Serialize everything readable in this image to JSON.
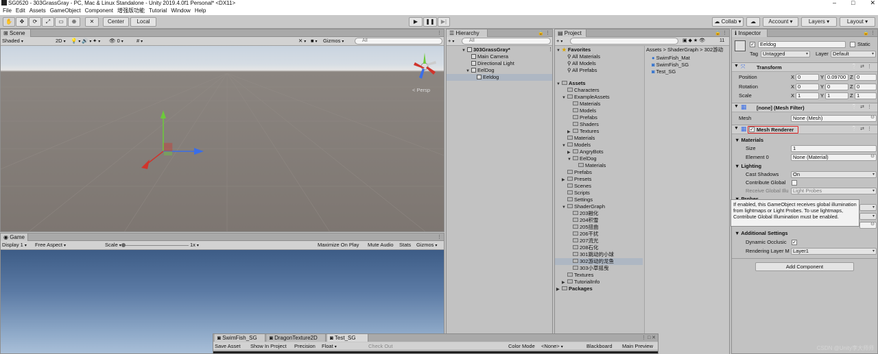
{
  "window": {
    "title": "SG0520 - 303GrassGray - PC, Mac & Linux Standalone - Unity 2019.4.0f1 Personal* <DX11>",
    "controls": [
      "–",
      "□",
      "✕"
    ]
  },
  "menu": [
    "File",
    "Edit",
    "Assets",
    "GameObject",
    "Component",
    "增强版功能",
    "Tutorial",
    "Window",
    "Help"
  ],
  "toolbar": {
    "pivot_label": "Center",
    "space_label": "Local",
    "play": "▶",
    "pause": "❚❚",
    "step": "▶|",
    "collab_label": "Collab",
    "account_label": "Account",
    "layers_label": "Layers",
    "layout_label": "Layout"
  },
  "scene": {
    "tab": "Scene",
    "shading": "Shaded",
    "mode_2d": "2D",
    "hidden_count": "0",
    "gizmos": "Gizmos",
    "search_placeholder": "All",
    "persp_label": "< Persp",
    "colors": {
      "x": "#d0342c",
      "y": "#6ccb3a",
      "z": "#3a6ee8"
    }
  },
  "game": {
    "tab": "Game",
    "display": "Display 1",
    "aspect": "Free Aspect",
    "scale_label": "Scale",
    "scale_value": "1x",
    "maximize": "Maximize On Play",
    "mute": "Mute Audio",
    "stats": "Stats",
    "gizmos": "Gizmos"
  },
  "hierarchy": {
    "tab": "Hierarchy",
    "search_placeholder": "All",
    "scene_name": "303GrassGray*",
    "items": [
      "Main Camera",
      "Directional Light",
      "EelDog",
      "Eeldog"
    ]
  },
  "project": {
    "tab": "Project",
    "count": "11",
    "favorites_label": "Favorites",
    "favorites": [
      "All Materials",
      "All Models",
      "All Prefabs"
    ],
    "assets_label": "Assets",
    "tree": [
      "Characters",
      "ExampleAssets",
      "Materials",
      "Models",
      "Prefabs",
      "Shaders",
      "Textures",
      "Materials",
      "Models",
      "AngryBots",
      "EelDog",
      "Materials",
      "Prefabs",
      "Presets",
      "Scenes",
      "Scripts",
      "Settings",
      "ShaderGraph",
      "203融化",
      "204积雪",
      "205扭曲",
      "206干扰",
      "207流光",
      "208石化",
      "301跳动的小球",
      "302游动的龙鱼",
      "303小草摇曳",
      "Textures",
      "TutorialInfo"
    ],
    "packages_label": "Packages",
    "breadcrumb": "Assets > ShaderGraph > 302游动",
    "files": [
      "SwimFish_Mat",
      "SwimFish_SG",
      "Test_SG"
    ]
  },
  "shadergraph": {
    "tabs": [
      "SwimFish_SG",
      "DragonTexture2D",
      "Test_SG"
    ],
    "save": "Save Asset",
    "show": "Show In Project",
    "precision_label": "Precision",
    "precision_value": "Float",
    "checkout": "Check Out",
    "colormode_label": "Color Mode",
    "colormode_value": "<None>",
    "blackboard": "Blackboard",
    "preview": "Main Preview"
  },
  "inspector": {
    "tab": "Inspector",
    "object_name": "Eeldog",
    "static_label": "Static",
    "tag_label": "Tag",
    "tag_value": "Untagged",
    "layer_label": "Layer",
    "layer_value": "Default",
    "transform": {
      "title": "Transform",
      "position_label": "Position",
      "position": [
        "0",
        "0.09700",
        "0"
      ],
      "rotation_label": "Rotation",
      "rotation": [
        "0",
        "0",
        "0"
      ],
      "scale_label": "Scale",
      "scale": [
        "1",
        "1",
        "1"
      ]
    },
    "mesh_filter": {
      "title": "[none] (Mesh Filter)",
      "mesh_label": "Mesh",
      "mesh_value": "None (Mesh)"
    },
    "mesh_renderer": {
      "title": "Mesh Renderer",
      "materials_label": "Materials",
      "size_label": "Size",
      "size_value": "1",
      "element_label": "Element 0",
      "element_value": "None (Material)",
      "lighting_label": "Lighting",
      "cast_label": "Cast Shadows",
      "cast_value": "On",
      "contrib_label": "Contribute Global",
      "receive_label": "Receive Global Illu",
      "receive_value": "Light Probes",
      "probes_label": "Probes",
      "tooltip": "If enabled, this GameObject receives global illumination from lightmaps or Light Probes. To use lightmaps, Contribute Global Illumination must be enabled.",
      "additional_label": "Additional Settings",
      "dynamic_label": "Dynamic Occlusic",
      "rendering_label": "Rendering Layer M",
      "rendering_value": "Layer1"
    },
    "add_component": "Add Component"
  },
  "watermark": "CSDN @Unity李大师师"
}
